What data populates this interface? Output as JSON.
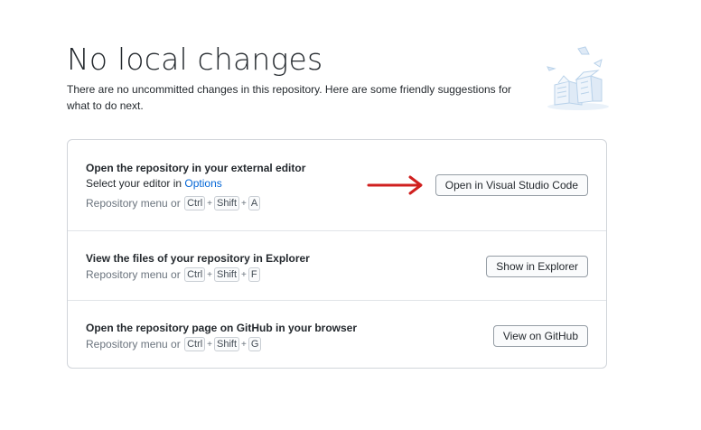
{
  "page": {
    "title": "No local changes",
    "subtitle": "There are no uncommitted changes in this repository. Here are some friendly suggestions for what to do next."
  },
  "suggestions": [
    {
      "title": "Open the repository in your external editor",
      "description_prefix": "Select your editor in ",
      "description_link": "Options",
      "shortcut_prefix": "Repository menu or",
      "keys": [
        "Ctrl",
        "Shift",
        "A"
      ],
      "button": "Open in Visual Studio Code"
    },
    {
      "title": "View the files of your repository in Explorer",
      "shortcut_prefix": "Repository menu or",
      "keys": [
        "Ctrl",
        "Shift",
        "F"
      ],
      "button": "Show in Explorer"
    },
    {
      "title": "Open the repository page on GitHub in your browser",
      "shortcut_prefix": "Repository menu or",
      "keys": [
        "Ctrl",
        "Shift",
        "G"
      ],
      "button": "View on GitHub"
    }
  ],
  "plus_sign": "+",
  "colors": {
    "link": "#0366d6",
    "annotation_arrow": "#d0201f",
    "illustration": "#c8dcef"
  },
  "icons": {
    "illustration": "boxes-illustration-icon",
    "annotation": "red-arrow-icon"
  }
}
